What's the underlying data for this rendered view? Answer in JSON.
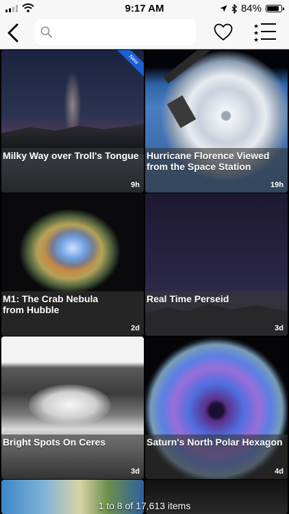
{
  "status": {
    "time": "9:17 AM",
    "battery": "84%",
    "battery_level": 0.84
  },
  "search": {
    "value": "",
    "placeholder": ""
  },
  "items": [
    {
      "title": "Milky Way over Troll's Tongue",
      "age": "9h",
      "badge": "New"
    },
    {
      "title": "Hurricane Florence Viewed\nfrom the Space Station",
      "age": "19h"
    },
    {
      "title": "M1: The Crab Nebula\nfrom Hubble",
      "age": "2d"
    },
    {
      "title": "Real Time Perseid",
      "age": "3d"
    },
    {
      "title": "Bright Spots On Ceres",
      "age": "3d"
    },
    {
      "title": "Saturn's North Polar Hexagon",
      "age": "4d"
    }
  ],
  "pager": "1 to 8 of 17,613 items",
  "icons": [
    "signal-icon",
    "wifi-icon",
    "location-icon",
    "bluetooth-icon",
    "battery-icon",
    "back-chevron-icon",
    "search-icon",
    "heart-icon",
    "starred-list-icon"
  ]
}
